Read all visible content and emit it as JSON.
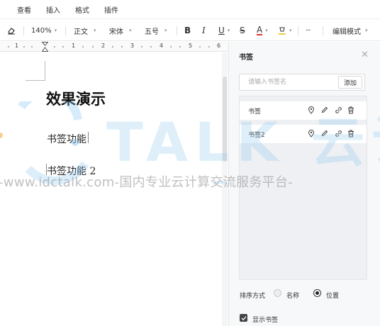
{
  "menubar": {
    "items": [
      "查看",
      "插入",
      "格式",
      "插件"
    ]
  },
  "toolbar": {
    "zoom": "140%",
    "style": "正文",
    "font": "宋体",
    "size": "五号",
    "more": "···",
    "mode": "编辑模式",
    "bold": "B",
    "italic": "I",
    "underline": "U",
    "strike": "S",
    "font_color": "A"
  },
  "ruler": {
    "labels": [
      "1",
      "1",
      "2",
      "3",
      "4",
      "5",
      "6"
    ]
  },
  "document": {
    "title": "效果演示",
    "line1": "书签功能",
    "line2": "书签功能 2"
  },
  "panel": {
    "title": "书签",
    "input_placeholder": "请输入书签名",
    "add_button": "添加",
    "bookmarks": [
      {
        "name": "书签"
      },
      {
        "name": "书签2"
      }
    ],
    "sort_label": "排序方式",
    "sort_options": [
      "名称",
      "位置"
    ],
    "sort_selected": "位置",
    "show_label": "显示书签",
    "show_checked": true
  },
  "watermark": {
    "logo_text": "TALK 云说",
    "url": "-www.idctalk.com-国内专业云计算交流服务平台-"
  },
  "colors": {
    "watermark_blue": "#8cc8f0",
    "watermark_orange": "#f5b04a",
    "accent": "#333333"
  }
}
